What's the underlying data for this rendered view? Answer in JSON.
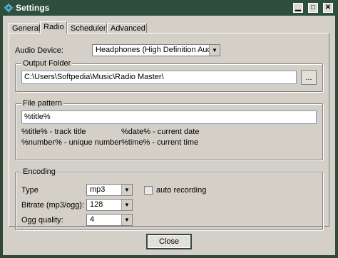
{
  "window": {
    "title": "Settings",
    "title_bg": "#2e4f3d"
  },
  "title_buttons": {
    "minimize": "▁",
    "maximize": "□",
    "close": "✕"
  },
  "tabs": [
    {
      "label": "General"
    },
    {
      "label": "Radio"
    },
    {
      "label": "Scheduler"
    },
    {
      "label": "Advanced"
    }
  ],
  "audio_device": {
    "label": "Audio Device:",
    "value": "Headphones (High Definition Audio D"
  },
  "output_folder": {
    "title": "Output Folder",
    "path": "C:\\Users\\Softpedia\\Music\\Radio Master\\",
    "browse_label": "..."
  },
  "file_pattern": {
    "title": "File pattern",
    "value": "%title%",
    "hints": [
      "%title% - track title",
      "%date% - current date",
      "%number% - unique number",
      "%time% - current time"
    ]
  },
  "encoding": {
    "title": "Encoding",
    "type_label": "Type",
    "type_value": "mp3",
    "auto_recording_label": "auto recording",
    "auto_recording_checked": false,
    "bitrate_label": "Bitrate (mp3/ogg):",
    "bitrate_value": "128",
    "ogg_label": "Ogg quality:",
    "ogg_value": "4"
  },
  "footer": {
    "close_label": "Close"
  }
}
